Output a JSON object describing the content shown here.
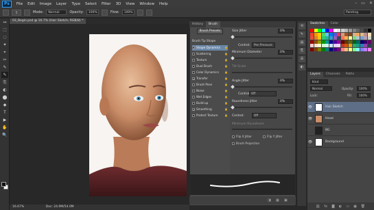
{
  "menubar": {
    "logo": "Ps",
    "items": [
      "File",
      "Edit",
      "Image",
      "Layer",
      "Type",
      "Select",
      "Filter",
      "3D",
      "View",
      "Window",
      "Help"
    ],
    "window_controls": [
      "–",
      "▭",
      "✕"
    ]
  },
  "options": {
    "mode_label": "Mode:",
    "mode_value": "Normal",
    "opacity_label": "Opacity:",
    "opacity_value": "100%",
    "flow_label": "Flow:",
    "flow_value": "100%",
    "brush_size": "5",
    "workspace": "Painting"
  },
  "document": {
    "tab_title": "03_Begin.psd @ 16.7% (Hair Sketch, RGB/8) *",
    "zoom": "16.67%",
    "doc_info": "Doc: 24.9M/54.0M"
  },
  "brush_panel": {
    "tabs": [
      "History",
      "Brush"
    ],
    "presets_button": "Brush Presets",
    "tip_shape_label": "Brush Tip Shape",
    "options": [
      {
        "label": "Shape Dynamics",
        "checked": true,
        "selected": true
      },
      {
        "label": "Scattering",
        "checked": false,
        "selected": false
      },
      {
        "label": "Texture",
        "checked": false,
        "selected": false
      },
      {
        "label": "Dual Brush",
        "checked": false,
        "selected": false
      },
      {
        "label": "Color Dynamics",
        "checked": false,
        "selected": false
      },
      {
        "label": "Transfer",
        "checked": true,
        "selected": false
      },
      {
        "label": "Brush Pose",
        "checked": false,
        "selected": false
      },
      {
        "label": "Noise",
        "checked": false,
        "selected": false
      },
      {
        "label": "Wet Edges",
        "checked": false,
        "selected": false
      },
      {
        "label": "Build-up",
        "checked": false,
        "selected": false
      },
      {
        "label": "Smoothing",
        "checked": true,
        "selected": false
      },
      {
        "label": "Protect Texture",
        "checked": false,
        "selected": false
      }
    ],
    "size_jitter_label": "Size Jitter",
    "size_jitter_value": "0%",
    "control_label": "Control:",
    "size_control_value": "Pen Pressure",
    "min_diameter_label": "Minimum Diameter",
    "min_diameter_value": "0%",
    "tilt_scale_label": "Tilt Scale",
    "angle_jitter_label": "Angle Jitter",
    "angle_jitter_value": "0%",
    "angle_control_value": "Off",
    "roundness_jitter_label": "Roundness Jitter",
    "roundness_jitter_value": "0%",
    "roundness_control_value": "Off",
    "min_roundness_label": "Minimum Roundness",
    "flip_x_label": "Flip X Jitter",
    "flip_y_label": "Flip Y Jitter",
    "projection_label": "Brush Projection"
  },
  "swatches_panel": {
    "tabs": [
      "Swatches",
      "Color"
    ],
    "colors": [
      "#ff0000",
      "#ffff00",
      "#00ff00",
      "#00ffff",
      "#0000ff",
      "#ff00ff",
      "#ffffff",
      "#e6e6e6",
      "#cccccc",
      "#b3b3b3",
      "#999999",
      "#808080",
      "#666666",
      "#4d4d4d",
      "#333333",
      "#000000",
      "#ff3b30",
      "#ff9500",
      "#ffcc00",
      "#4cd964",
      "#5ac8fa",
      "#007aff",
      "#5856d6",
      "#ff2d55",
      "#c7a17a",
      "#a0522d",
      "#8b4513",
      "#d2b48c",
      "#f4a460",
      "#deb887",
      "#bc8f8f",
      "#f5deb3",
      "#e74c3c",
      "#e67e22",
      "#f1c40f",
      "#2ecc71",
      "#1abc9c",
      "#3498db",
      "#9b59b6",
      "#34495e",
      "#ff6f61",
      "#ffb347",
      "#fdfd96",
      "#77dd77",
      "#aec6cf",
      "#779ecb",
      "#b39eb5",
      "#cfcfc4",
      "#990000",
      "#994c00",
      "#999900",
      "#009900",
      "#009999",
      "#000099",
      "#4c0099",
      "#990099",
      "#660000",
      "#663300",
      "#666600",
      "#006600",
      "#006666",
      "#000066",
      "#330066",
      "#660066",
      "#ffcccc",
      "#ffe5cc",
      "#ffffcc",
      "#ccffcc",
      "#ccffff",
      "#cce5ff",
      "#e5ccff",
      "#ffccff",
      "#c0392b",
      "#d35400",
      "#f39c12",
      "#27ae60",
      "#16a085",
      "#2980b9",
      "#8e44ad",
      "#2c3e50",
      "#7f0000",
      "#7f3f00",
      "#7f7f00",
      "#007f00",
      "#007f7f",
      "#00007f",
      "#3f007f",
      "#7f007f",
      "#ff7f7f",
      "#ffbf7f",
      "#ffff7f",
      "#7fff7f",
      "#7fffff",
      "#7f7fff",
      "#bf7fff",
      "#ff7fff"
    ]
  },
  "layers_panel": {
    "tabs": [
      "Layers",
      "Channels",
      "Paths"
    ],
    "kind_label": "Kind",
    "blend_value": "Normal",
    "opacity_label": "Opacity:",
    "opacity_value": "100%",
    "lock_label": "Lock:",
    "fill_label": "Fill:",
    "fill_value": "100%",
    "layers": [
      {
        "name": "Hair Sketch",
        "selected": true,
        "visible": true
      },
      {
        "name": "Head",
        "selected": false,
        "visible": true
      },
      {
        "name": "BG",
        "selected": false,
        "visible": false
      },
      {
        "name": "Background",
        "selected": false,
        "visible": true
      }
    ]
  },
  "tools": [
    "↔",
    "⬚",
    "◌",
    "✦",
    "⌖",
    "✂",
    "✎",
    "✎",
    "⎘",
    "◐",
    "⬤",
    "◆",
    "T",
    "▶",
    "✋",
    "🔍"
  ],
  "colors": {
    "accent": "#2fa3ff",
    "selection": "#6a86a6",
    "layer_selection": "#5d6e86"
  }
}
